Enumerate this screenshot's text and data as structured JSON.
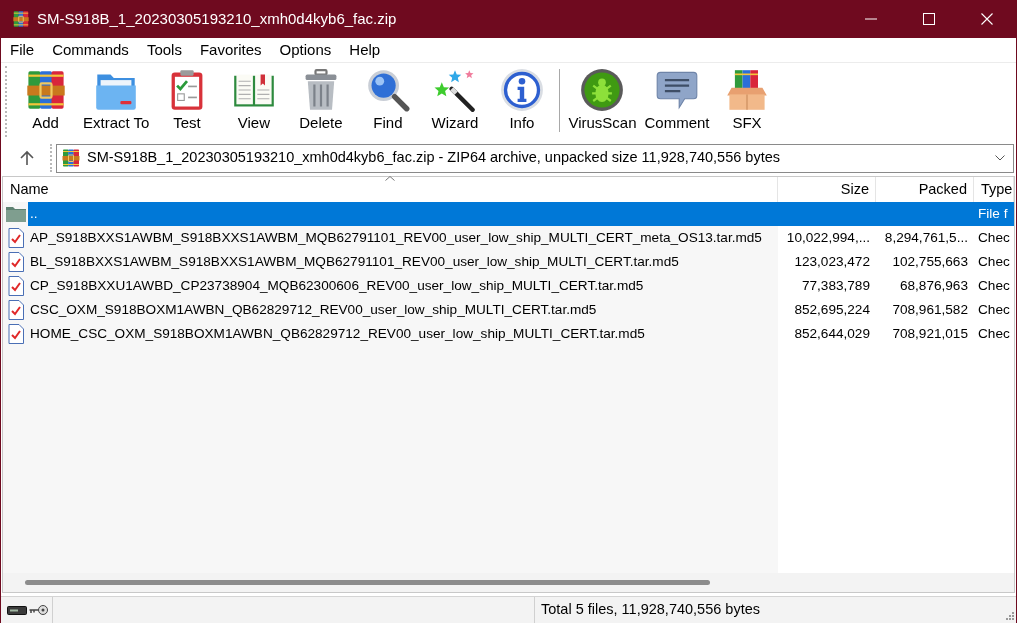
{
  "window": {
    "title": "SM-S918B_1_20230305193210_xmh0d4kyb6_fac.zip"
  },
  "menu": [
    "File",
    "Commands",
    "Tools",
    "Favorites",
    "Options",
    "Help"
  ],
  "toolbar_groups": [
    {
      "buttons": [
        "Add",
        "Extract To",
        "Test",
        "View",
        "Delete",
        "Find",
        "Wizard",
        "Info"
      ]
    },
    {
      "buttons": [
        "VirusScan",
        "Comment",
        "SFX"
      ]
    }
  ],
  "address_bar": {
    "value": "SM-S918B_1_20230305193210_xmh0d4kyb6_fac.zip - ZIP64 archive, unpacked size 11,928,740,556 bytes"
  },
  "table": {
    "columns": [
      {
        "label": "Name",
        "sorted": true
      },
      {
        "label": "Size",
        "sorted": false
      },
      {
        "label": "Packed",
        "sorted": false
      },
      {
        "label": "Type",
        "sorted": false
      }
    ],
    "rows": [
      {
        "kind": "folder",
        "name": "..",
        "type": "File f",
        "selected": true
      },
      {
        "kind": "file",
        "name": "AP_S918BXXS1AWBM_S918BXXS1AWBM_MQB62791101_REV00_user_low_ship_MULTI_CERT_meta_OS13.tar.md5",
        "size": "10,022,994,...",
        "packed": "8,294,761,5...",
        "type": "Chec",
        "selected": false
      },
      {
        "kind": "file",
        "name": "BL_S918BXXS1AWBM_S918BXXS1AWBM_MQB62791101_REV00_user_low_ship_MULTI_CERT.tar.md5",
        "size": "123,023,472",
        "packed": "102,755,663",
        "type": "Chec",
        "selected": false
      },
      {
        "kind": "file",
        "name": "CP_S918BXXU1AWBD_CP23738904_MQB62300606_REV00_user_low_ship_MULTI_CERT.tar.md5",
        "size": "77,383,789",
        "packed": "68,876,963",
        "type": "Chec",
        "selected": false
      },
      {
        "kind": "file",
        "name": "CSC_OXM_S918BOXM1AWBN_QB62829712_REV00_user_low_ship_MULTI_CERT.tar.md5",
        "size": "852,695,224",
        "packed": "708,961,582",
        "type": "Chec",
        "selected": false
      },
      {
        "kind": "file",
        "name": "HOME_CSC_OXM_S918BOXM1AWBN_QB62829712_REV00_user_low_ship_MULTI_CERT.tar.md5",
        "size": "852,644,029",
        "packed": "708,921,015",
        "type": "Chec",
        "selected": false
      }
    ]
  },
  "status_bar": {
    "text": "Total 5 files, 11,928,740,556 bytes"
  }
}
